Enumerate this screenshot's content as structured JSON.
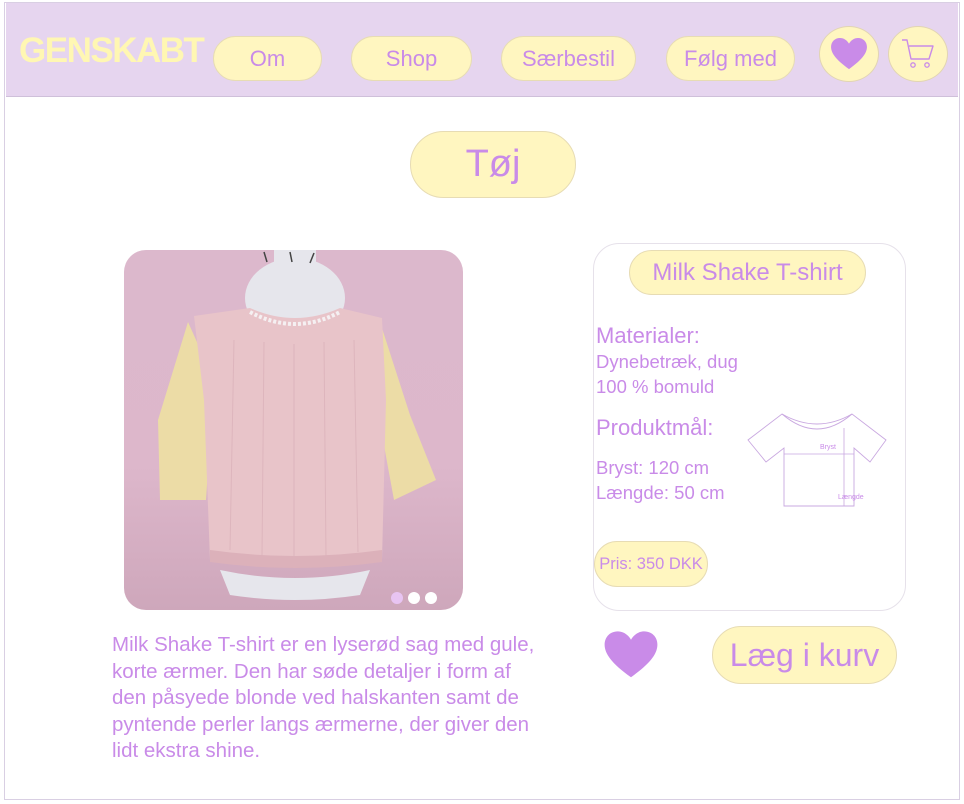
{
  "header": {
    "logo": "GENSKABT",
    "nav": [
      {
        "label": "Om"
      },
      {
        "label": "Shop"
      },
      {
        "label": "Særbestil"
      },
      {
        "label": "Følg med"
      }
    ],
    "favorites_icon": "heart-icon",
    "cart_icon": "cart-icon"
  },
  "page": {
    "category": "Tøj"
  },
  "product": {
    "name": "Milk Shake T-shirt",
    "materials_heading": "Materialer:",
    "materials": [
      "Dynebetræk, dug",
      "100 % bomuld"
    ],
    "dimensions_heading": "Produktmål:",
    "dimensions": [
      "Bryst: 120 cm",
      "Længde: 50 cm"
    ],
    "diagram_labels": {
      "chest": "Bryst",
      "length": "Længde"
    },
    "price": "Pris: 350 DKK",
    "description": "Milk Shake T-shirt er en lyserød sag med gule, korte ærmer. Den har søde detaljer i form af den påsyede blonde ved halskanten samt de pyntende perler langs ærmerne, der giver den lidt ekstra shine.",
    "add_to_cart": "Læg i kurv",
    "carousel": {
      "count": 3,
      "active": 1
    }
  },
  "colors": {
    "header_bg": "#e6d5ef",
    "pill_bg": "#fff6c0",
    "accent": "#c98be8",
    "logo": "#fff7b3"
  }
}
